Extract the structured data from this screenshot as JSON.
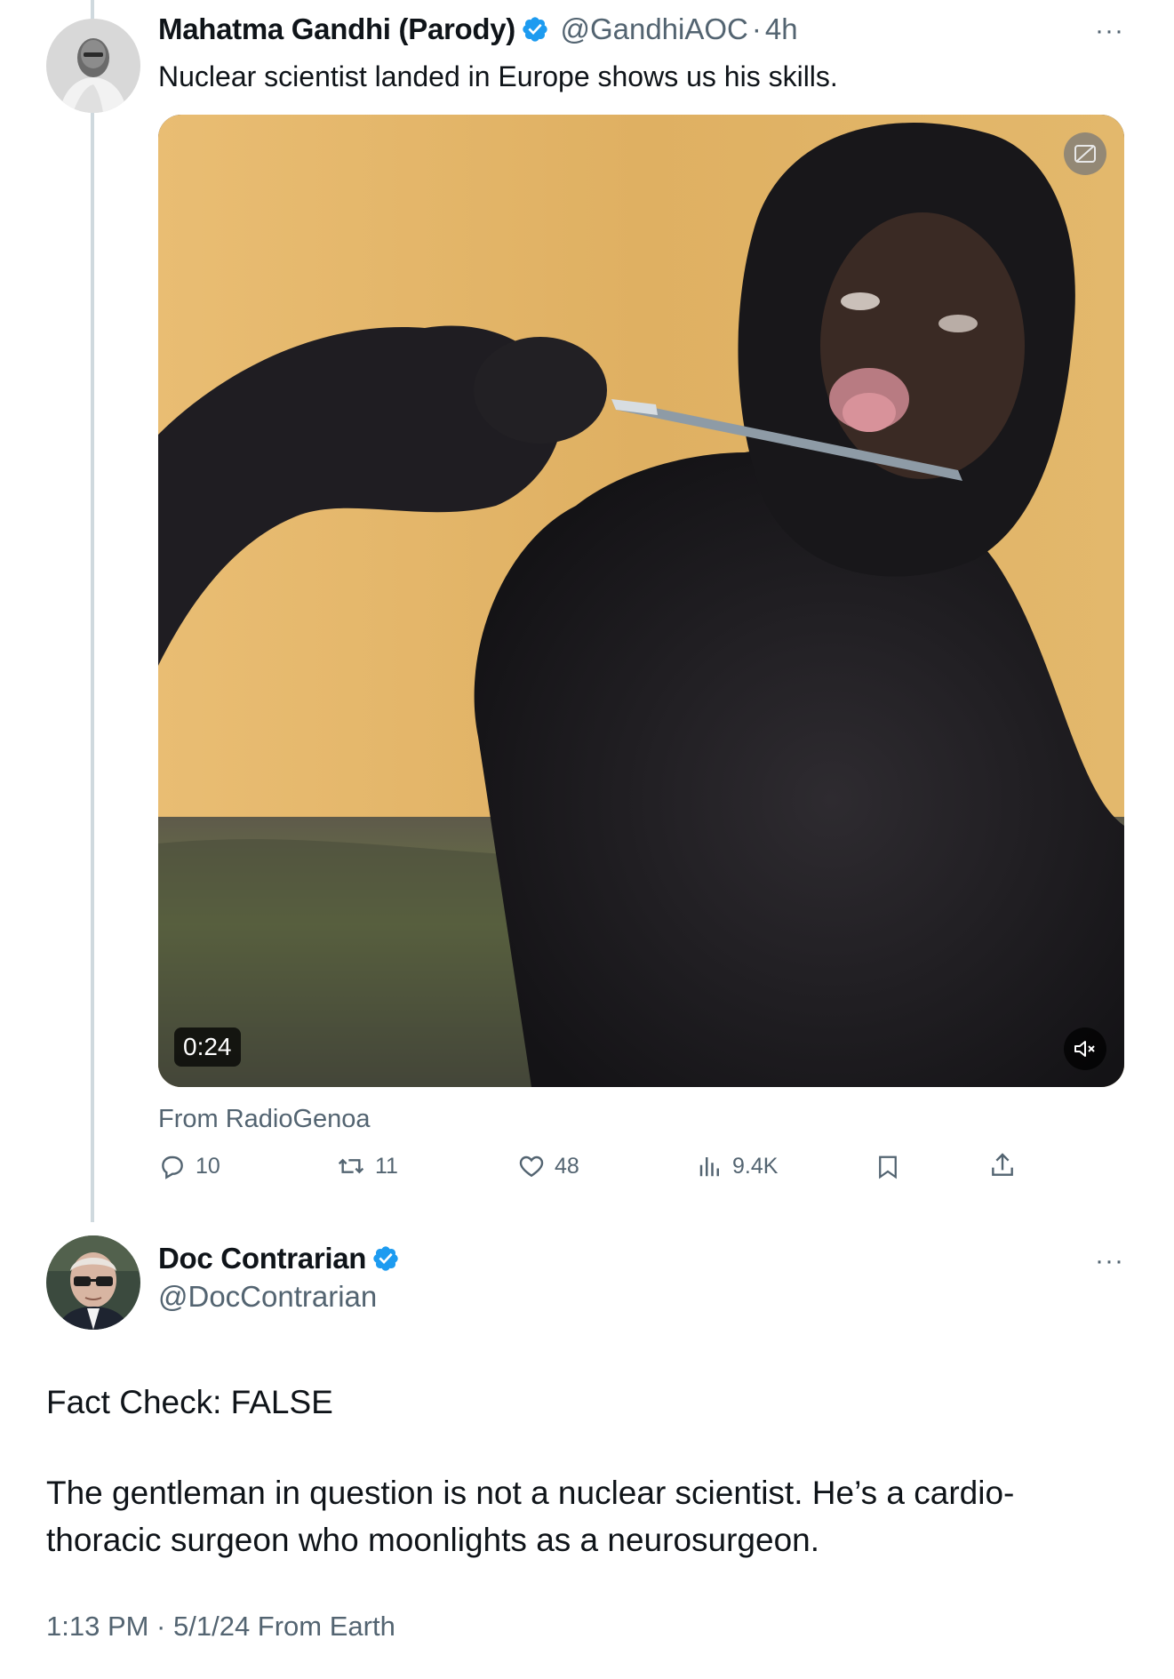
{
  "tweet1": {
    "display_name": "Mahatma Gandhi (Parody)",
    "handle": "@GandhiAOC",
    "separator": "·",
    "time": "4h",
    "more": "···",
    "text": "Nuclear scientist landed in Europe shows us his skills.",
    "video": {
      "duration": "0:24",
      "from_label": "From RadioGenoa"
    },
    "actions": {
      "replies": "10",
      "reposts": "11",
      "likes": "48",
      "views": "9.4K"
    }
  },
  "tweet2": {
    "display_name": "Doc Contrarian",
    "handle": "@DocContrarian",
    "more": "···",
    "text_line1": "Fact Check: FALSE",
    "text_para_l1": "The gentleman in question is not a nuclear scientist. He’s a cardio-",
    "text_para_l2": "thoracic surgeon who moonlights as a neurosurgeon.",
    "meta": "1:13 PM · 5/1/24 From Earth"
  },
  "colors": {
    "verified": "#1d9bf0",
    "secondary_text": "#536471",
    "thread_line": "#cfd9de"
  },
  "icons": [
    "reply-icon",
    "repost-icon",
    "like-icon",
    "views-icon",
    "bookmark-icon",
    "share-icon",
    "verified-icon",
    "mute-icon",
    "media-settings-icon"
  ]
}
